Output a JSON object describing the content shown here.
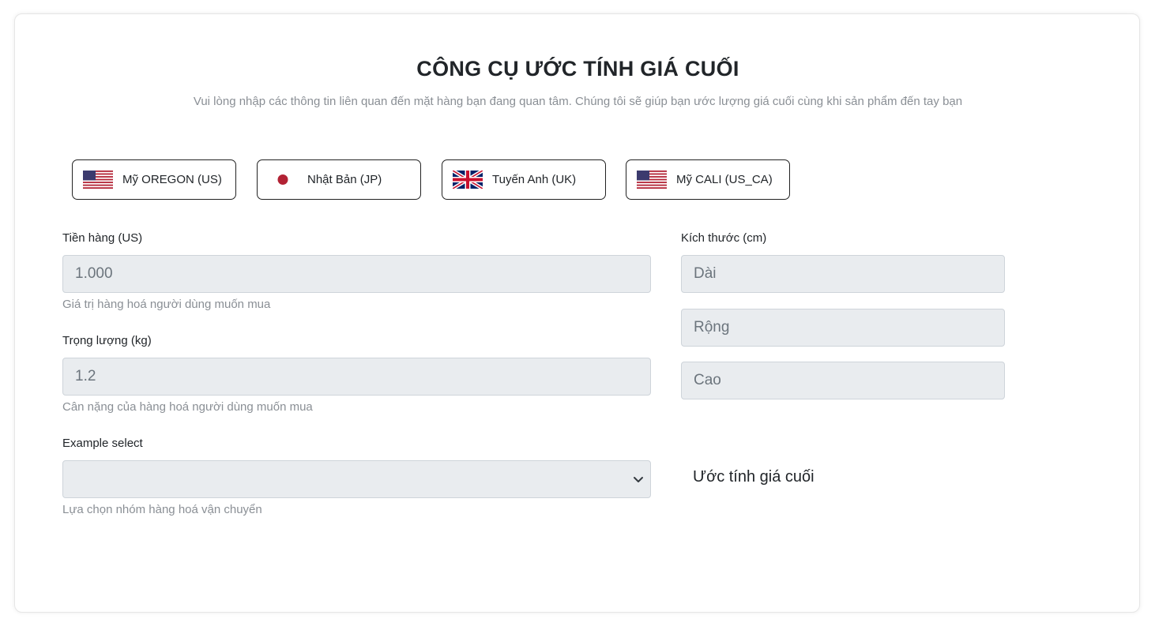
{
  "header": {
    "title": "CÔNG CỤ ƯỚC TÍNH GIÁ CUỐI",
    "subtitle": "Vui lòng nhập các thông tin liên quan đến mặt hàng bạn đang quan tâm. Chúng tôi sẽ giúp bạn ước lượng giá cuối cùng khi sản phẩm đến tay bạn"
  },
  "countries": [
    {
      "label": "Mỹ OREGON (US)",
      "flag": "us-flag-icon"
    },
    {
      "label": "Nhật Bản (JP)",
      "flag": "jp-flag-icon"
    },
    {
      "label": "Tuyến Anh (UK)",
      "flag": "uk-flag-icon"
    },
    {
      "label": "Mỹ CALI (US_CA)",
      "flag": "us-flag-icon"
    }
  ],
  "form": {
    "price": {
      "label": "Tiền hàng (US)",
      "value": "1.000",
      "help": "Giá trị hàng hoá người dùng muốn mua"
    },
    "weight": {
      "label": "Trọng lượng (kg)",
      "value": "1.2",
      "help": "Cân nặng của hàng hoá người dùng muốn mua"
    },
    "category": {
      "label": "Example select",
      "value": "",
      "help": "Lựa chọn nhóm hàng hoá vận chuyển"
    },
    "size": {
      "label": "Kích thước (cm)",
      "length_placeholder": "Dài",
      "width_placeholder": "Rộng",
      "height_placeholder": "Cao"
    },
    "submit_label": "Ước tính giá cuối"
  },
  "colors": {
    "input_bg": "#e9ecef",
    "muted_text": "#8a8f95",
    "flag_red": "#b22234",
    "flag_blue": "#3c3b6e",
    "uk_blue": "#012169",
    "uk_red": "#c8102e"
  }
}
